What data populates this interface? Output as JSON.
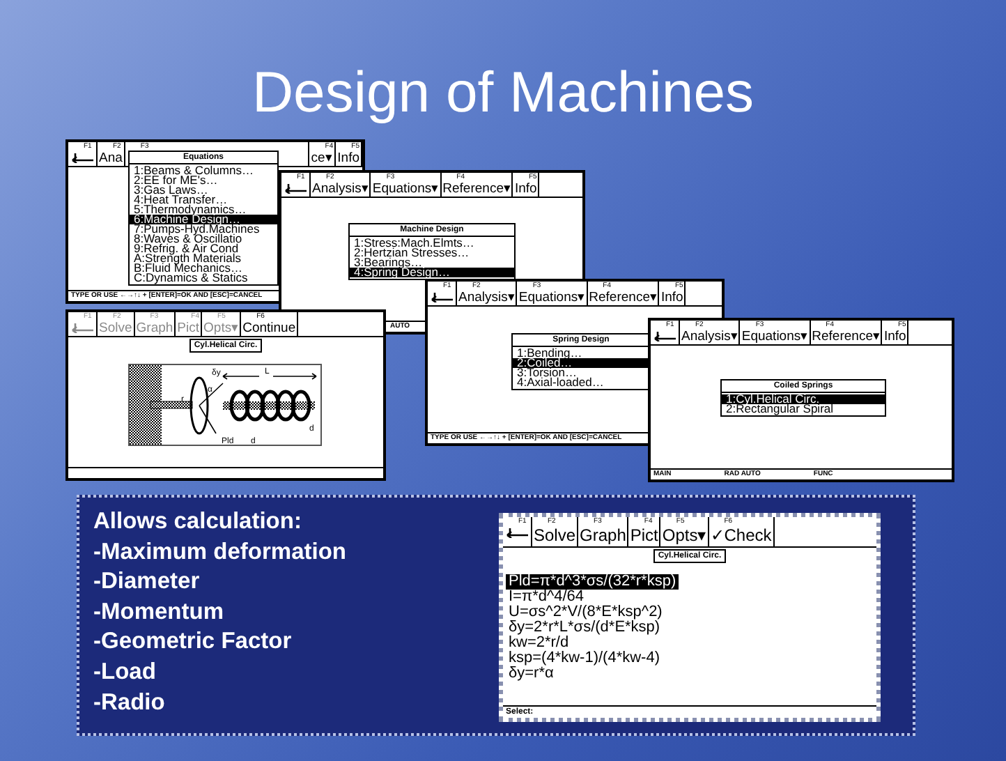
{
  "title": "Design of Machines",
  "screens": [
    {
      "kind": "menu",
      "tabs": [
        {
          "fkey": "F1",
          "kind": "icon",
          "disabled": false
        },
        {
          "fkey": "F2",
          "kind": "text",
          "label": "Ana",
          "disabled": false
        },
        {
          "fkey": "F3",
          "kind": "text",
          "disabled": false
        },
        {
          "fkey": "F4",
          "kind": "text",
          "label": "ce▾",
          "disabled": false
        },
        {
          "fkey": "F5",
          "kind": "text",
          "label": "Info",
          "disabled": false
        }
      ],
      "menu": {
        "title": "Equations",
        "items": [
          {
            "label": "1:Beams & Columns…",
            "selected": false
          },
          {
            "label": "2:EE for ME's…",
            "selected": false
          },
          {
            "label": "3:Gas Laws…",
            "selected": false
          },
          {
            "label": "4:Heat Transfer…",
            "selected": false
          },
          {
            "label": "5:Thermodynamics…",
            "selected": false
          },
          {
            "label": "6:Machine Design…",
            "selected": true
          },
          {
            "label": "7:Pumps-Hyd.Machines",
            "selected": false
          },
          {
            "label": "8:Waves & Oscillatio",
            "selected": false
          },
          {
            "label": "9:Refrig. & Air Cond",
            "selected": false
          },
          {
            "label": "A:Strength Materials",
            "selected": false
          },
          {
            "label": "B:Fluid Mechanics…",
            "selected": false
          },
          {
            "label": "C:Dynamics & Statics",
            "selected": false
          }
        ]
      },
      "status_bar": [
        "TYPE OR USE ←→↑↓ + [ENTER]=OK AND [ESC]=CANCEL"
      ]
    },
    {
      "kind": "menu",
      "tabs": [
        {
          "fkey": "F1",
          "kind": "icon",
          "disabled": false
        },
        {
          "fkey": "F2",
          "kind": "text",
          "label": "Analysis▾",
          "disabled": false
        },
        {
          "fkey": "F3",
          "kind": "text",
          "label": "Equations▾",
          "disabled": false
        },
        {
          "fkey": "F4",
          "kind": "text",
          "label": "Reference▾",
          "disabled": false
        },
        {
          "fkey": "F5",
          "kind": "text",
          "label": "Info",
          "disabled": false
        }
      ],
      "menu": {
        "title": "Machine Design",
        "items": [
          {
            "label": "1:Stress:Mach.Elmts…",
            "selected": false
          },
          {
            "label": "2:Hertzian Stresses…",
            "selected": false
          },
          {
            "label": "3:Bearings…",
            "selected": false
          },
          {
            "label": "4:Spring Design…",
            "selected": true
          }
        ]
      },
      "status_bar": [
        "AUTO"
      ]
    },
    {
      "kind": "picture",
      "tabs": [
        {
          "fkey": "F1",
          "kind": "icon",
          "disabled": true
        },
        {
          "fkey": "F2",
          "kind": "text",
          "label": "Solve",
          "disabled": true
        },
        {
          "fkey": "F3",
          "kind": "text",
          "label": "Graph",
          "disabled": true
        },
        {
          "fkey": "F4",
          "kind": "text",
          "label": "Pict",
          "disabled": true
        },
        {
          "fkey": "F5",
          "kind": "text",
          "label": "Opts▾",
          "disabled": true
        },
        {
          "fkey": "F6",
          "kind": "text",
          "label": "Continue",
          "disabled": false
        }
      ],
      "heading": "Cyl.Helical Circ.",
      "drawing_labels": [
        "δy",
        "α",
        "r",
        "Pld",
        "L",
        "d",
        "d"
      ]
    },
    {
      "kind": "menu",
      "tabs": [
        {
          "fkey": "F1",
          "kind": "icon",
          "disabled": false
        },
        {
          "fkey": "F2",
          "kind": "text",
          "label": "Analysis▾",
          "disabled": false
        },
        {
          "fkey": "F3",
          "kind": "text",
          "label": "Equations▾",
          "disabled": false
        },
        {
          "fkey": "F4",
          "kind": "text",
          "label": "Reference▾",
          "disabled": false
        },
        {
          "fkey": "F5",
          "kind": "text",
          "label": "Info",
          "disabled": false
        }
      ],
      "menu": {
        "title": "Spring Design",
        "items": [
          {
            "label": "1:Bending…",
            "selected": false
          },
          {
            "label": "2:Coiled…",
            "selected": true
          },
          {
            "label": "3:Torsion…",
            "selected": false
          },
          {
            "label": "4:Axial-loaded…",
            "selected": false
          }
        ]
      },
      "status_bar": [
        "TYPE OR USE ←→↑↓ + [ENTER]=OK AND [ESC]=CANCEL"
      ]
    },
    {
      "kind": "menu",
      "tabs": [
        {
          "fkey": "F1",
          "kind": "icon",
          "disabled": false
        },
        {
          "fkey": "F2",
          "kind": "text",
          "label": "Analysis▾",
          "disabled": false
        },
        {
          "fkey": "F3",
          "kind": "text",
          "label": "Equations▾",
          "disabled": false
        },
        {
          "fkey": "F4",
          "kind": "text",
          "label": "Reference▾",
          "disabled": false
        },
        {
          "fkey": "F5",
          "kind": "text",
          "label": "Info",
          "disabled": false
        }
      ],
      "menu": {
        "title": "Coiled Springs",
        "items": [
          {
            "label": "1:Cyl.Helical Circ.",
            "selected": true
          },
          {
            "label": "2:Rectangular Spiral",
            "selected": false
          }
        ]
      },
      "status_bar": [
        "MAIN",
        "RAD AUTO",
        "FUNC"
      ]
    }
  ],
  "panel": {
    "heading": "Allows calculation:",
    "items": [
      "-Maximum deformation",
      "-Diameter",
      "-Momentum",
      "-Geometric Factor",
      "-Load",
      "-Radio"
    ],
    "calculator": {
      "kind": "equations",
      "tabs": [
        {
          "fkey": "F1",
          "kind": "icon",
          "disabled": false
        },
        {
          "fkey": "F2",
          "kind": "text",
          "label": "Solve",
          "disabled": false
        },
        {
          "fkey": "F3",
          "kind": "text",
          "label": "Graph",
          "disabled": false
        },
        {
          "fkey": "F4",
          "kind": "text",
          "label": "Pict",
          "disabled": false
        },
        {
          "fkey": "F5",
          "kind": "text",
          "label": "Opts▾",
          "disabled": false
        },
        {
          "fkey": "F6",
          "kind": "text",
          "label": "✓Check",
          "disabled": false
        }
      ],
      "heading": "Cyl.Helical Circ.",
      "equations": [
        {
          "text": "Pld=π*d^3*σs/(32*r*ksp)",
          "selected": true
        },
        {
          "text": "I=π*d^4/64",
          "selected": false
        },
        {
          "text": "U=σs^2*V/(8*E*ksp^2)",
          "selected": false
        },
        {
          "text": "δy=2*r*L*σs/(d*E*ksp)",
          "selected": false
        },
        {
          "text": "kw=2*r/d",
          "selected": false
        },
        {
          "text": "ksp=(4*kw-1)/(4*kw-4)",
          "selected": false
        },
        {
          "text": "δy=r*α",
          "selected": false
        }
      ],
      "status_bar": [
        "Select:"
      ]
    }
  }
}
